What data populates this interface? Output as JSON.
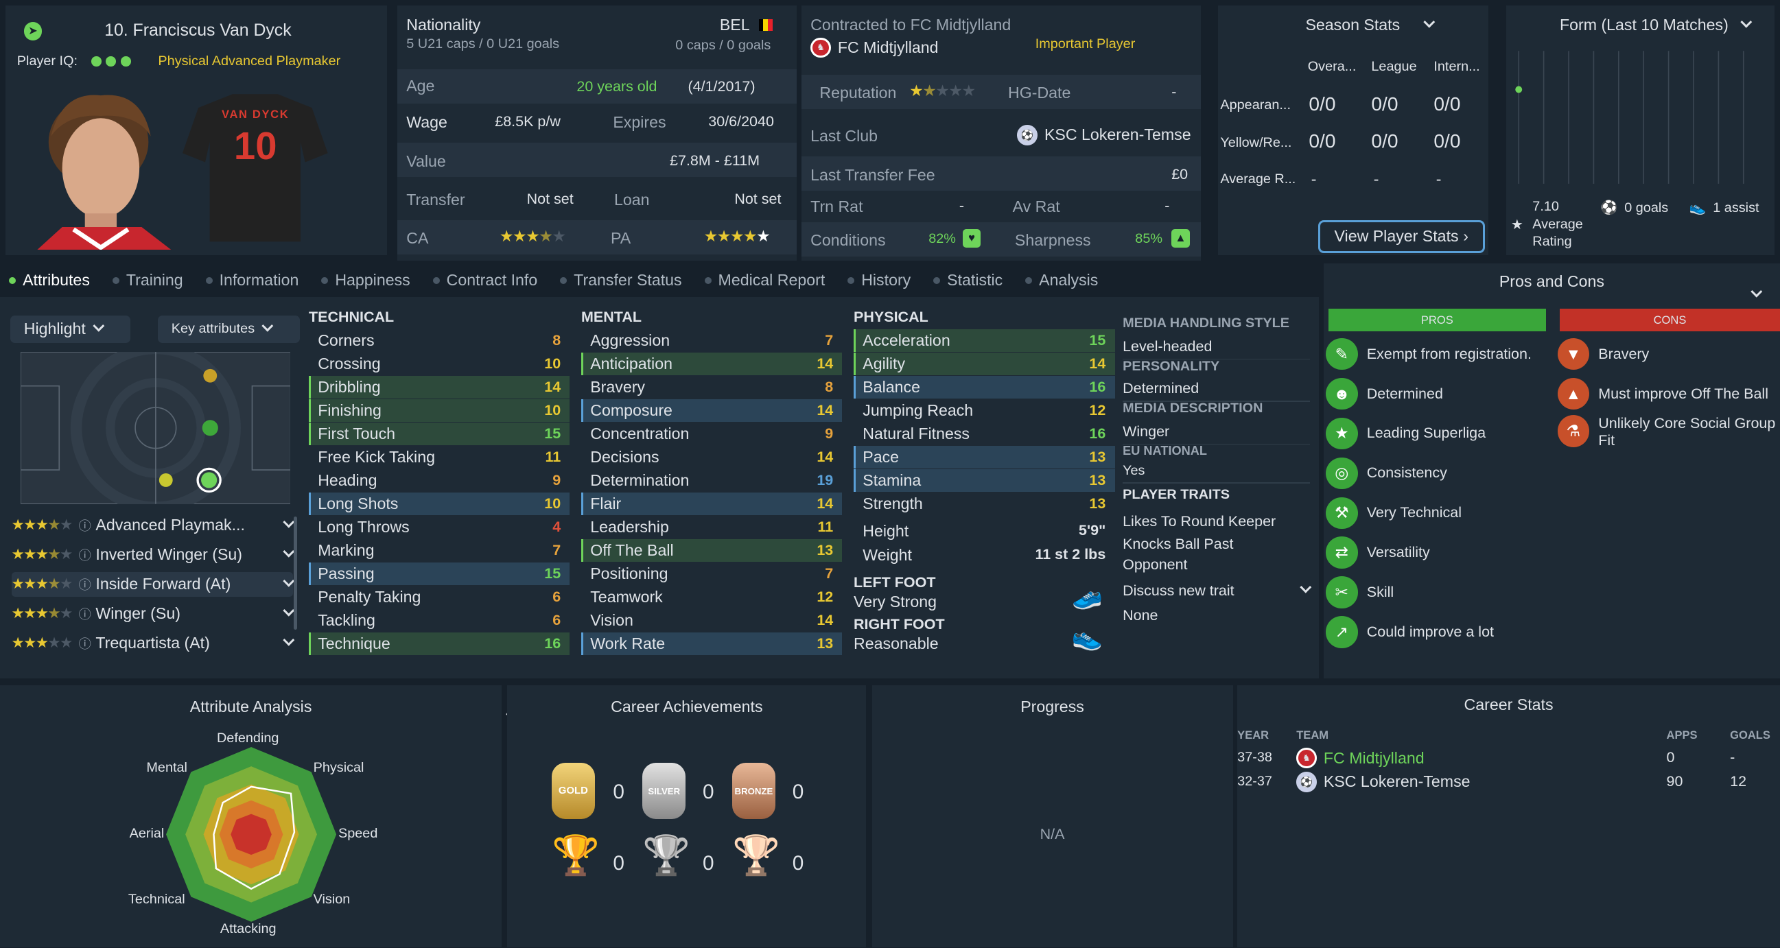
{
  "player": {
    "name": "10. Franciscus Van Dyck",
    "iq_label": "Player IQ:",
    "role": "Physical Advanced Playmaker",
    "shirt_name": "VAN DYCK",
    "shirt_number": "10"
  },
  "nationality": {
    "label": "Nationality",
    "code": "BEL",
    "u21": "5 U21 caps / 0 U21 goals",
    "caps": "0 caps / 0 goals"
  },
  "age": {
    "label": "Age",
    "value": "20 years old",
    "date": "(4/1/2017)"
  },
  "wage": {
    "label": "Wage",
    "value": "£8.5K p/w",
    "expires_label": "Expires",
    "expires": "30/6/2040"
  },
  "value": {
    "label": "Value",
    "value": "£7.8M - £11M"
  },
  "transfer": {
    "label": "Transfer",
    "value": "Not set",
    "loan_label": "Loan",
    "loan_value": "Not set"
  },
  "ability": {
    "ca_label": "CA",
    "pa_label": "PA",
    "ca_stars": 3.5,
    "pa_stars": 5
  },
  "contract": {
    "label": "Contracted to FC Midtjylland",
    "club": "FC Midtjylland",
    "status": "Important Player",
    "rep_label": "Reputation",
    "rep_stars": 1.5,
    "hg_label": "HG-Date",
    "hg_value": "-",
    "last_club_label": "Last Club",
    "last_club": "KSC Lokeren-Temse",
    "fee_label": "Last Transfer Fee",
    "fee": "£0",
    "trn_label": "Trn Rat",
    "trn_value": "-",
    "av_label": "Av Rat",
    "av_value": "-",
    "cond_label": "Conditions",
    "cond_value": "82%",
    "sharp_label": "Sharpness",
    "sharp_value": "85%"
  },
  "season": {
    "title": "Season Stats",
    "cols": [
      "Overa...",
      "League",
      "Intern..."
    ],
    "rows": [
      {
        "label": "Appearan...",
        "vals": [
          "0/0",
          "0/0",
          "0/0"
        ]
      },
      {
        "label": "Yellow/Re...",
        "vals": [
          "0/0",
          "0/0",
          "0/0"
        ]
      },
      {
        "label": "Average R...",
        "vals": [
          "-",
          "-",
          "-"
        ]
      }
    ],
    "button": "View Player Stats"
  },
  "form": {
    "title": "Form (Last 10 Matches)",
    "rating": "7.10",
    "rating_label1": "Average",
    "rating_label2": "Rating",
    "goals": "0 goals",
    "assists": "1 assist"
  },
  "tabs": [
    "Attributes",
    "Training",
    "Information",
    "Happiness",
    "Contract Info",
    "Transfer Status",
    "Medical Report",
    "History",
    "Statistic",
    "Analysis"
  ],
  "controls": {
    "highlight": "Highlight",
    "key": "Key attributes"
  },
  "technical": {
    "title": "TECHNICAL",
    "items": [
      [
        "Corners",
        "8"
      ],
      [
        "Crossing",
        "10"
      ],
      [
        "Dribbling",
        "14"
      ],
      [
        "Finishing",
        "10"
      ],
      [
        "First Touch",
        "15"
      ],
      [
        "Free Kick Taking",
        "11"
      ],
      [
        "Heading",
        "9"
      ],
      [
        "Long Shots",
        "10"
      ],
      [
        "Long Throws",
        "4"
      ],
      [
        "Marking",
        "7"
      ],
      [
        "Passing",
        "15"
      ],
      [
        "Penalty Taking",
        "6"
      ],
      [
        "Tackling",
        "6"
      ],
      [
        "Technique",
        "16"
      ]
    ]
  },
  "mental": {
    "title": "MENTAL",
    "items": [
      [
        "Aggression",
        "7"
      ],
      [
        "Anticipation",
        "14"
      ],
      [
        "Bravery",
        "8"
      ],
      [
        "Composure",
        "14"
      ],
      [
        "Concentration",
        "9"
      ],
      [
        "Decisions",
        "14"
      ],
      [
        "Determination",
        "19"
      ],
      [
        "Flair",
        "14"
      ],
      [
        "Leadership",
        "11"
      ],
      [
        "Off The Ball",
        "13"
      ],
      [
        "Positioning",
        "7"
      ],
      [
        "Teamwork",
        "12"
      ],
      [
        "Vision",
        "14"
      ],
      [
        "Work Rate",
        "13"
      ]
    ]
  },
  "physical": {
    "title": "PHYSICAL",
    "items": [
      [
        "Acceleration",
        "15"
      ],
      [
        "Agility",
        "14"
      ],
      [
        "Balance",
        "16"
      ],
      [
        "Jumping Reach",
        "12"
      ],
      [
        "Natural Fitness",
        "16"
      ],
      [
        "Pace",
        "13"
      ],
      [
        "Stamina",
        "13"
      ],
      [
        "Strength",
        "13"
      ]
    ],
    "height_label": "Height",
    "height": "5'9\"",
    "weight_label": "Weight",
    "weight": "11 st 2 lbs",
    "left_label": "LEFT FOOT",
    "left": "Very Strong",
    "right_label": "RIGHT FOOT",
    "right": "Reasonable"
  },
  "media": {
    "style_label": "MEDIA HANDLING STYLE",
    "style": "Level-headed",
    "pers_label": "PERSONALITY",
    "pers": "Determined",
    "desc_label": "MEDIA DESCRIPTION",
    "desc": "Winger",
    "eu_label": "EU NATIONAL",
    "eu": "Yes",
    "traits_label": "PLAYER TRAITS",
    "trait1": "Likes To Round Keeper",
    "trait2a": "Knocks Ball Past",
    "trait2b": "Opponent",
    "discuss": "Discuss new trait",
    "none": "None"
  },
  "roles": [
    {
      "name": "Advanced Playmak...",
      "stars": 3.5
    },
    {
      "name": "Inverted Winger (Su)",
      "stars": 3.5
    },
    {
      "name": "Inside Forward (At)",
      "stars": 3.5
    },
    {
      "name": "Winger (Su)",
      "stars": 3.5
    },
    {
      "name": "Trequartista (At)",
      "stars": 3
    }
  ],
  "pros_cons": {
    "title": "Pros and Cons",
    "pros_label": "PROS",
    "cons_label": "CONS",
    "pros": [
      "Exempt from registration.",
      "Determined",
      "Leading Superliga",
      "Consistency",
      "Very Technical",
      "Versatility",
      "Skill",
      "Could improve a lot"
    ],
    "cons": [
      "Bravery",
      "Must improve Off The Ball",
      "Unlikely Core Social Group",
      "Fit"
    ]
  },
  "analysis": {
    "title": "Attribute Analysis",
    "labels": [
      "Defending",
      "Physical",
      "Speed",
      "Vision",
      "Attacking",
      "Technical",
      "Aerial",
      "Mental"
    ]
  },
  "achievements": {
    "title": "Career Achievements",
    "gold": "GOLD",
    "silver": "SILVER",
    "bronze": "BRONZE",
    "medal_counts": [
      "0",
      "0",
      "0"
    ],
    "trophy_counts": [
      "0",
      "0",
      "0"
    ]
  },
  "progress": {
    "title": "Progress",
    "value": "N/A"
  },
  "career": {
    "title": "Career Stats",
    "cols": [
      "YEAR",
      "TEAM",
      "APPS",
      "GOALS"
    ],
    "rows": [
      {
        "year": "37-38",
        "team": "FC Midtjylland",
        "apps": "0",
        "goals": "-"
      },
      {
        "year": "32-37",
        "team": "KSC Lokeren-Temse",
        "apps": "90",
        "goals": "12"
      }
    ]
  },
  "colors": {
    "pros": "#3aa63a",
    "cons": "#c23127",
    "accent": "#6ed45a",
    "gold": "#e8c832"
  }
}
